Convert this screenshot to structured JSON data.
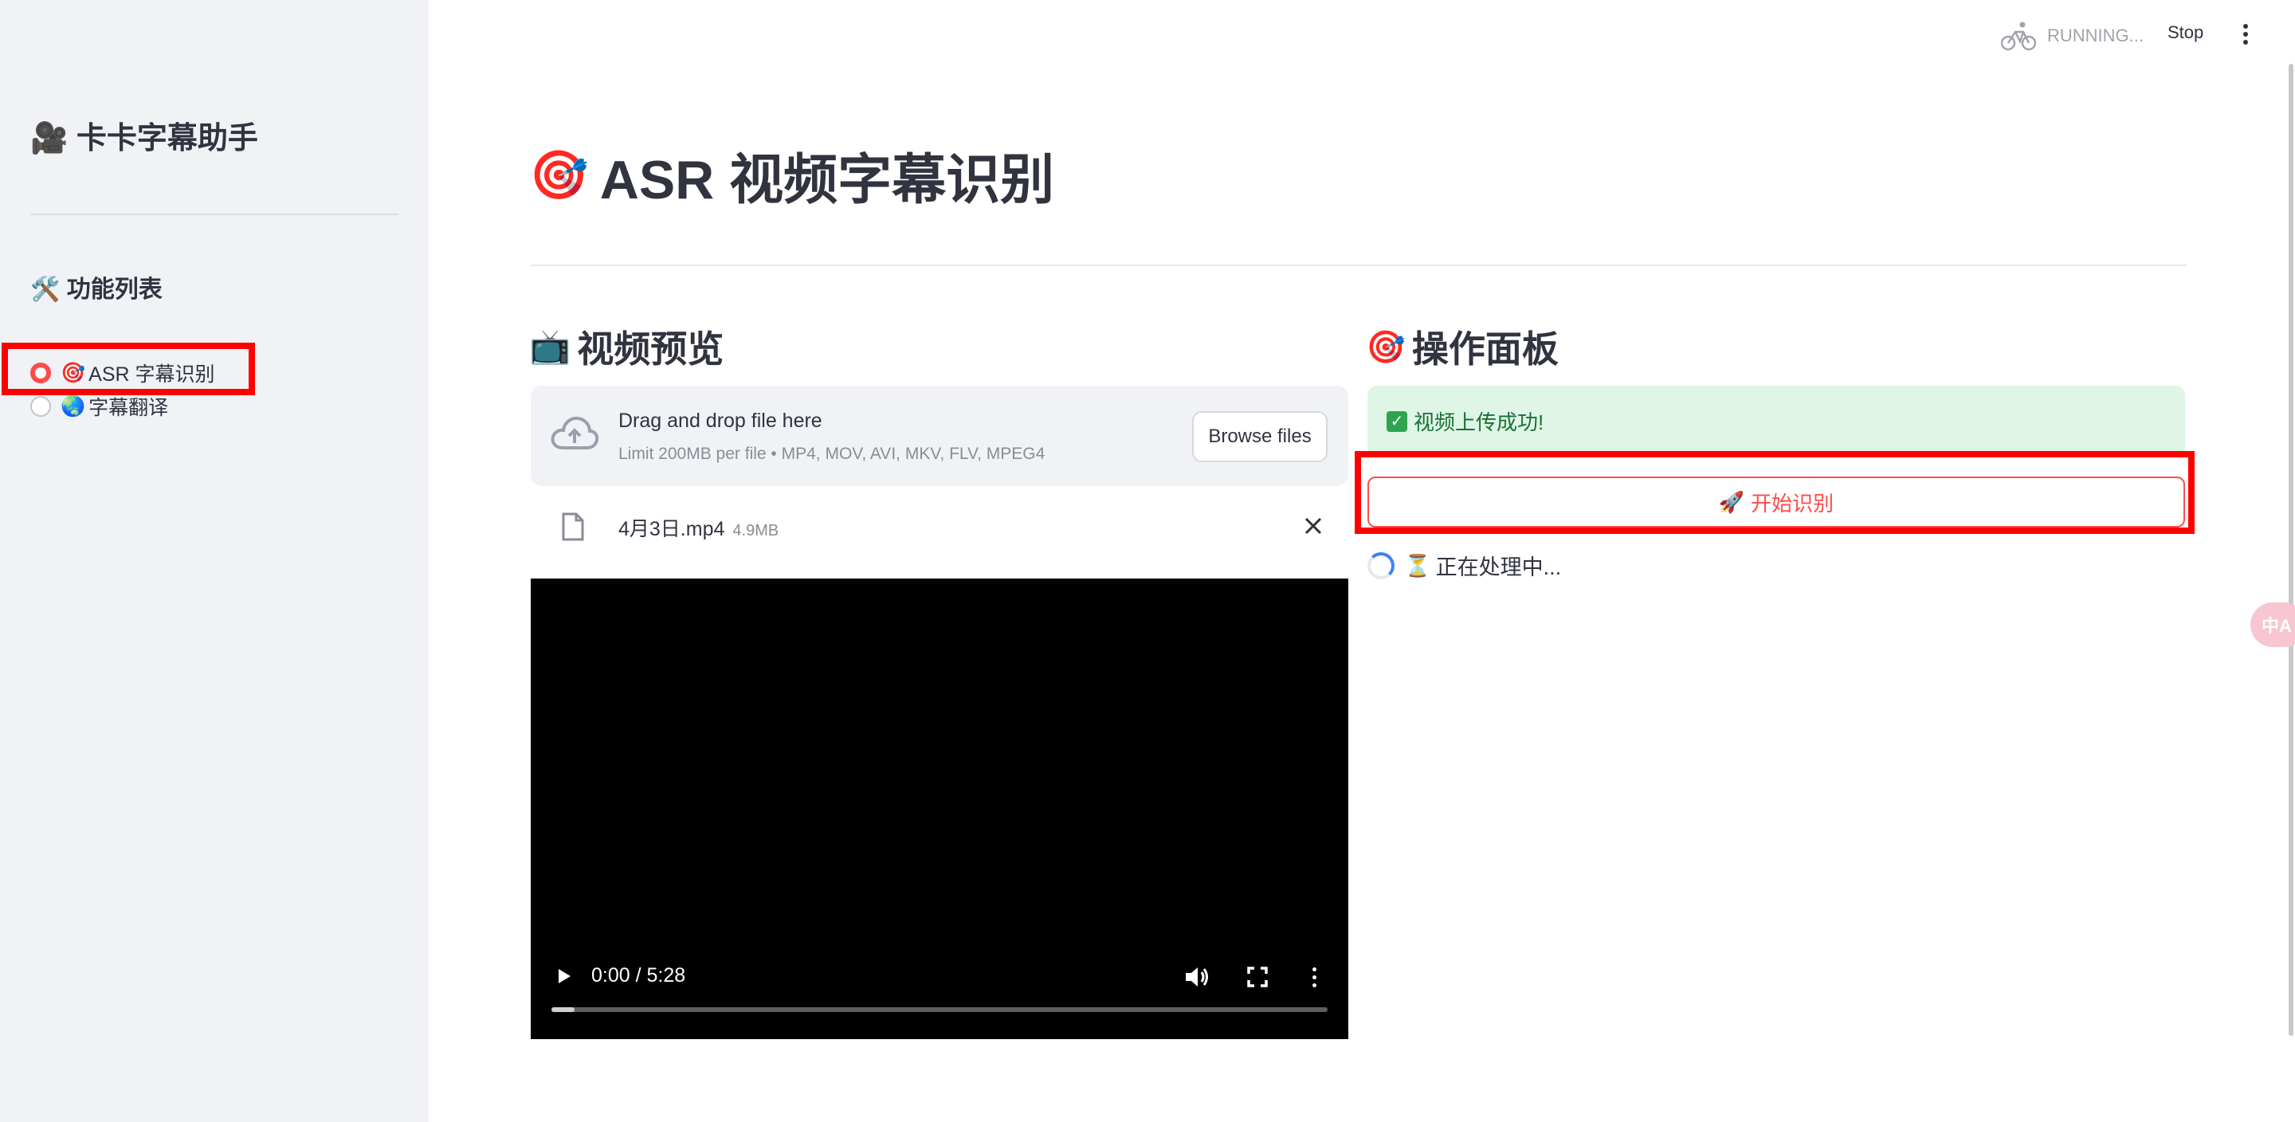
{
  "sidebar": {
    "title_icon": "🎥",
    "title": "卡卡字幕助手",
    "subtitle_icon": "🛠️",
    "subtitle": "功能列表",
    "items": [
      {
        "icon": "🎯",
        "label": "ASR 字幕识别",
        "selected": true
      },
      {
        "icon": "🌏",
        "label": "字幕翻译",
        "selected": false
      }
    ]
  },
  "header": {
    "status": "RUNNING...",
    "stop_label": "Stop"
  },
  "main": {
    "title_icon": "🎯",
    "title": "ASR 视频字幕识别",
    "preview": {
      "title_icon": "📺",
      "title": "视频预览",
      "uploader": {
        "drop_text": "Drag and drop file here",
        "limit_text": "Limit 200MB per file • MP4, MOV, AVI, MKV, FLV, MPEG4",
        "browse_label": "Browse files"
      },
      "file": {
        "name": "4月3日.mp4",
        "size": "4.9MB"
      },
      "video": {
        "time": "0:00 / 5:28",
        "progress": 0.03
      }
    },
    "panel": {
      "title_icon": "🎯",
      "title": "操作面板",
      "success_icon": "✓",
      "success_text": "视频上传成功!",
      "start_icon": "🚀",
      "start_label": "开始识别",
      "processing_icon": "⏳",
      "processing_text": "正在处理中..."
    }
  },
  "fab": {
    "label": "中A"
  },
  "colors": {
    "accent": "#ff4b4b",
    "success_bg": "#dff5e6",
    "success_text": "#177233",
    "sidebar_bg": "#f0f2f6"
  }
}
